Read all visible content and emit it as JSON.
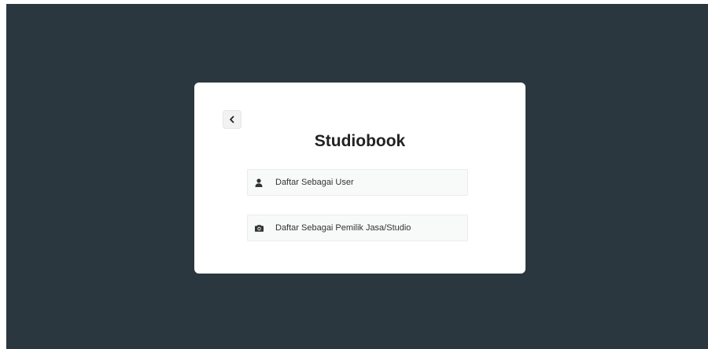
{
  "app": {
    "title": "Studiobook"
  },
  "back_button": {
    "icon": "chevron-left-icon"
  },
  "options": [
    {
      "label": "Daftar Sebagai User",
      "icon": "user-icon"
    },
    {
      "label": "Daftar Sebagai Pemilik Jasa/Studio",
      "icon": "camera-icon"
    }
  ],
  "colors": {
    "page_background": "#2b373f",
    "card_background": "#ffffff",
    "option_background": "#f8f9f9",
    "title_text": "#222222"
  }
}
